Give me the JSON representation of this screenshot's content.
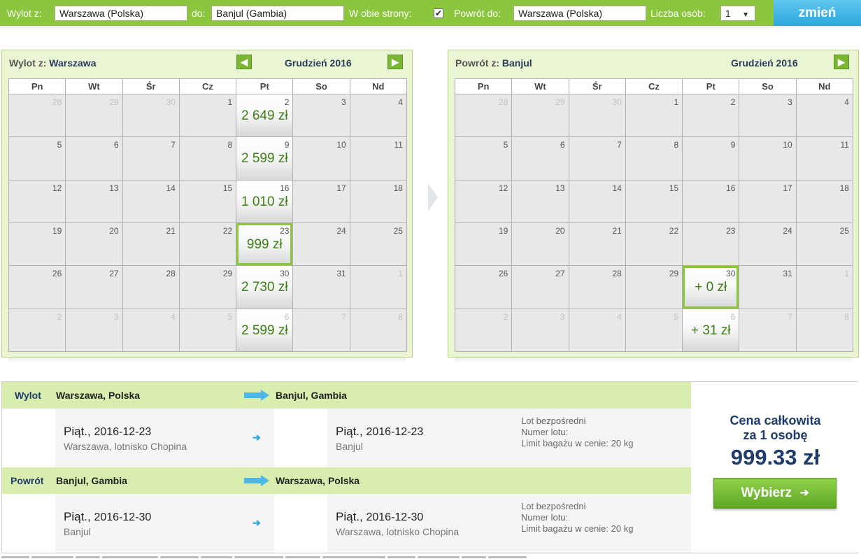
{
  "search": {
    "from_label": "Wylot z:",
    "from_value": "Warszawa (Polska)",
    "to_label": "do:",
    "to_value": "Banjul (Gambia)",
    "roundtrip_label": "W obie strony:",
    "roundtrip_checked": "✔",
    "return_label": "Powrót do:",
    "return_value": "Warszawa (Polska)",
    "passengers_label": "Liczba osób:",
    "passengers_value": "1",
    "change_button": "zmień"
  },
  "outbound_calendar": {
    "title_prefix": "Wylot z:",
    "title_city": "Warszawa",
    "month": "Grudzień 2016",
    "weekdays": [
      "Pn",
      "Wt",
      "Śr",
      "Cz",
      "Pt",
      "So",
      "Nd"
    ],
    "days": [
      {
        "n": "28",
        "muted": true
      },
      {
        "n": "29",
        "muted": true
      },
      {
        "n": "30",
        "muted": true
      },
      {
        "n": "1"
      },
      {
        "n": "2",
        "price": "2 649 zł"
      },
      {
        "n": "3"
      },
      {
        "n": "4"
      },
      {
        "n": "5"
      },
      {
        "n": "6"
      },
      {
        "n": "7"
      },
      {
        "n": "8"
      },
      {
        "n": "9",
        "price": "2 599 zł"
      },
      {
        "n": "10"
      },
      {
        "n": "11"
      },
      {
        "n": "12"
      },
      {
        "n": "13"
      },
      {
        "n": "14"
      },
      {
        "n": "15"
      },
      {
        "n": "16",
        "price": "1 010 zł"
      },
      {
        "n": "17"
      },
      {
        "n": "18"
      },
      {
        "n": "19"
      },
      {
        "n": "20"
      },
      {
        "n": "21"
      },
      {
        "n": "22"
      },
      {
        "n": "23",
        "price": "999 zł",
        "selected": true
      },
      {
        "n": "24"
      },
      {
        "n": "25"
      },
      {
        "n": "26"
      },
      {
        "n": "27"
      },
      {
        "n": "28"
      },
      {
        "n": "29"
      },
      {
        "n": "30",
        "price": "2 730 zł"
      },
      {
        "n": "31"
      },
      {
        "n": "1",
        "muted": true
      },
      {
        "n": "2",
        "muted": true
      },
      {
        "n": "3",
        "muted": true
      },
      {
        "n": "4",
        "muted": true
      },
      {
        "n": "5",
        "muted": true
      },
      {
        "n": "6",
        "muted": true,
        "price": "2 599 zł"
      },
      {
        "n": "7",
        "muted": true
      },
      {
        "n": "8",
        "muted": true
      }
    ]
  },
  "return_calendar": {
    "title_prefix": "Powrót z:",
    "title_city": "Banjul",
    "month": "Grudzień 2016",
    "weekdays": [
      "Pn",
      "Wt",
      "Śr",
      "Cz",
      "Pt",
      "So",
      "Nd"
    ],
    "days": [
      {
        "n": "28",
        "muted": true
      },
      {
        "n": "29",
        "muted": true
      },
      {
        "n": "30",
        "muted": true
      },
      {
        "n": "1"
      },
      {
        "n": "2"
      },
      {
        "n": "3"
      },
      {
        "n": "4"
      },
      {
        "n": "5"
      },
      {
        "n": "6"
      },
      {
        "n": "7"
      },
      {
        "n": "8"
      },
      {
        "n": "9"
      },
      {
        "n": "10"
      },
      {
        "n": "11"
      },
      {
        "n": "12"
      },
      {
        "n": "13"
      },
      {
        "n": "14"
      },
      {
        "n": "15"
      },
      {
        "n": "16"
      },
      {
        "n": "17"
      },
      {
        "n": "18"
      },
      {
        "n": "19"
      },
      {
        "n": "20"
      },
      {
        "n": "21"
      },
      {
        "n": "22"
      },
      {
        "n": "23"
      },
      {
        "n": "24"
      },
      {
        "n": "25"
      },
      {
        "n": "26"
      },
      {
        "n": "27"
      },
      {
        "n": "28"
      },
      {
        "n": "29"
      },
      {
        "n": "30",
        "price": "+ 0 zł",
        "selected": true
      },
      {
        "n": "31"
      },
      {
        "n": "1",
        "muted": true
      },
      {
        "n": "2",
        "muted": true
      },
      {
        "n": "3",
        "muted": true
      },
      {
        "n": "4",
        "muted": true
      },
      {
        "n": "5",
        "muted": true
      },
      {
        "n": "6",
        "muted": true,
        "price": "+ 31 zł"
      },
      {
        "n": "7",
        "muted": true
      },
      {
        "n": "8",
        "muted": true
      }
    ]
  },
  "summary": {
    "outbound": {
      "type": "Wylot",
      "from": "Warszawa, Polska",
      "to": "Banjul, Gambia",
      "dep_day": "Piąt.,",
      "dep_date": "2016-12-23",
      "dep_place": "Warszawa, lotnisko Chopina",
      "arr_day": "Piąt.,",
      "arr_date": "2016-12-23",
      "arr_place": "Banjul",
      "info_direct": "Lot bezpośredni",
      "info_flight_no": "Numer lotu:",
      "info_baggage": "Limit bagażu w cenie: 20 kg"
    },
    "return": {
      "type": "Powrót",
      "from": "Banjul, Gambia",
      "to": "Warszawa, Polska",
      "dep_day": "Piąt.,",
      "dep_date": "2016-12-30",
      "dep_place": "Banjul",
      "arr_day": "Piąt.,",
      "arr_date": "2016-12-30",
      "arr_place": "Warszawa, lotnisko Chopina",
      "info_direct": "Lot bezpośredni",
      "info_flight_no": "Numer lotu:",
      "info_baggage": "Limit bagażu w cenie: 20 kg"
    },
    "total_label_line1": "Cena całkowita",
    "total_label_line2": "za 1 osobę",
    "total_price": "999.33 zł",
    "select_button": "Wybierz"
  },
  "colors": {
    "brand_green": "#8cc63f",
    "price_green": "#3d7f18",
    "accent_blue": "#2ea7dc",
    "navy": "#1d3b6c"
  },
  "icons": {
    "nav_prev": "arrow-left-icon",
    "nav_next": "arrow-right-icon",
    "leg_arrow": "big-arrow-right-icon",
    "small_arrow": "small-arrow-right-icon"
  }
}
